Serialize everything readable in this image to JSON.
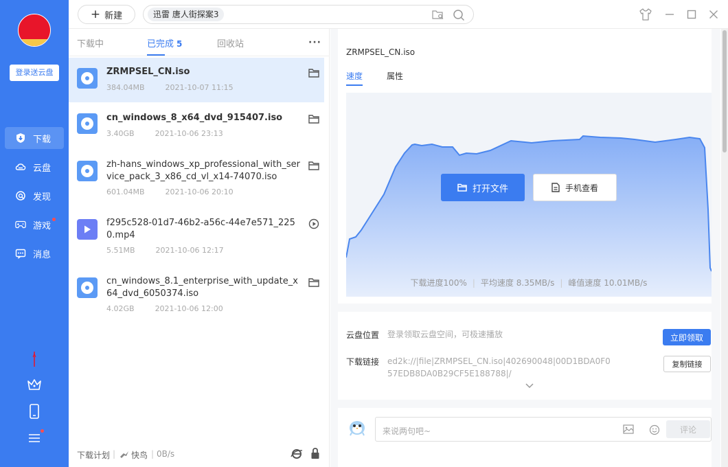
{
  "sidebar": {
    "login_label": "登录送云盘",
    "items": [
      {
        "label": "下载",
        "icon": "download-shield-icon",
        "active": true
      },
      {
        "label": "云盘",
        "icon": "cloud-icon",
        "active": false
      },
      {
        "label": "发现",
        "icon": "discover-icon",
        "active": false
      },
      {
        "label": "游戏",
        "icon": "gamepad-icon",
        "active": false,
        "badge": true
      },
      {
        "label": "消息",
        "icon": "message-icon",
        "active": false
      }
    ],
    "bottom_icons": [
      "lightning-icon",
      "crown-icon",
      "phone-icon",
      "menu-icon"
    ]
  },
  "topbar": {
    "new_label": "新建",
    "search_tag": "迅雷  唐人街探案3",
    "icons": [
      "folder-search-icon",
      "search-icon"
    ],
    "window_controls": [
      "skin-icon",
      "minimize-icon",
      "maximize-icon",
      "close-icon"
    ]
  },
  "list": {
    "tabs": [
      {
        "label": "下载中",
        "count": ""
      },
      {
        "label": "已完成",
        "count": "5"
      },
      {
        "label": "回收站",
        "count": ""
      }
    ],
    "more_label": "···",
    "items": [
      {
        "name": "ZRMPSEL_CN.iso",
        "size": "384.04MB",
        "date": "2021-10-07 11:15",
        "type": "disc",
        "action": "folder-icon"
      },
      {
        "name": "cn_windows_8_x64_dvd_915407.iso",
        "size": "3.40GB",
        "date": "2021-10-06 23:13",
        "type": "disc",
        "action": "folder-icon"
      },
      {
        "name": "zh-hans_windows_xp_professional_with_service_pack_3_x86_cd_vl_x14-74070.iso",
        "size": "601.04MB",
        "date": "2021-10-06 20:10",
        "type": "disc",
        "action": "folder-icon"
      },
      {
        "name": "f295c528-01d7-46b2-a56c-44e7e571_2250.mp4",
        "size": "5.51MB",
        "date": "2021-10-06 12:17",
        "type": "video",
        "action": "play-icon"
      },
      {
        "name": "cn_windows_8.1_enterprise_with_update_x64_dvd_6050374.iso",
        "size": "4.02GB",
        "date": "2021-10-06 12:00",
        "type": "disc",
        "action": "folder-icon"
      }
    ],
    "footer": {
      "plan": "下载计划",
      "bird": "快鸟",
      "speed": "0B/s"
    }
  },
  "detail": {
    "title": "ZRMPSEL_CN.iso",
    "tabs": [
      "速度",
      "属性"
    ],
    "open_label": "打开文件",
    "phone_label": "手机查看",
    "progress": "下载进度100%",
    "avg_speed": "平均速度 8.35MB/s",
    "peak_speed": "峰值速度 10.01MB/s",
    "cloud_label": "云盘位置",
    "cloud_value": "登录领取云盘空间，可极速播放",
    "claim_label": "立即领取",
    "link_label": "下载链接",
    "link_value": "ed2k://|file|ZRMPSEL_CN.iso|402690048|00D1BDA0F057EDB8DA0B29CF5E188788|/",
    "copy_label": "复制链接",
    "comment_placeholder": "来说两句吧~",
    "comment_button": "评论"
  },
  "colors": {
    "accent": "#3b7cf0",
    "sidebar": "#3b7cf0",
    "chart_fill_top": "#8db4f6",
    "chart_line": "#4a86ee"
  }
}
